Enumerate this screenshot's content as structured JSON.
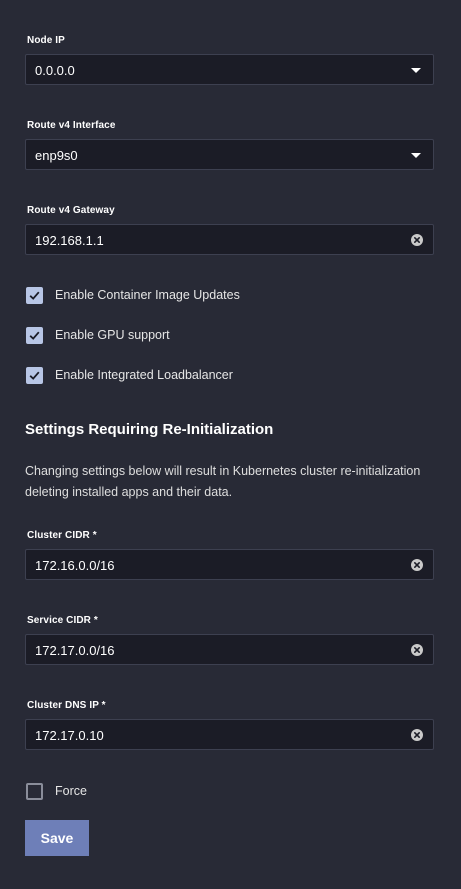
{
  "fields": {
    "node_ip": {
      "label": "Node IP",
      "value": "0.0.0.0"
    },
    "route_v4_interface": {
      "label": "Route v4 Interface",
      "value": "enp9s0"
    },
    "route_v4_gateway": {
      "label": "Route v4 Gateway",
      "value": "192.168.1.1"
    },
    "cluster_cidr": {
      "label": "Cluster CIDR *",
      "value": "172.16.0.0/16"
    },
    "service_cidr": {
      "label": "Service CIDR *",
      "value": "172.17.0.0/16"
    },
    "cluster_dns_ip": {
      "label": "Cluster DNS IP *",
      "value": "172.17.0.10"
    }
  },
  "checkboxes": {
    "container_image_updates": {
      "label": "Enable Container Image Updates",
      "checked": true
    },
    "gpu_support": {
      "label": "Enable GPU support",
      "checked": true
    },
    "integrated_loadbalancer": {
      "label": "Enable Integrated Loadbalancer",
      "checked": true
    },
    "force": {
      "label": "Force",
      "checked": false
    }
  },
  "reinit_section": {
    "title": "Settings Requiring Re-Initialization",
    "description": "Changing settings below will result in Kubernetes cluster re-initialization deleting installed apps and their data."
  },
  "actions": {
    "save_label": "Save"
  },
  "colors": {
    "background": "#282a36",
    "input_background": "#1b1c26",
    "checkbox_checked": "#b8c6e6",
    "primary_button": "#6e7fb8"
  },
  "icons": {
    "select_caret": "caret-down-icon",
    "clear": "clear-icon",
    "check": "check-icon"
  }
}
